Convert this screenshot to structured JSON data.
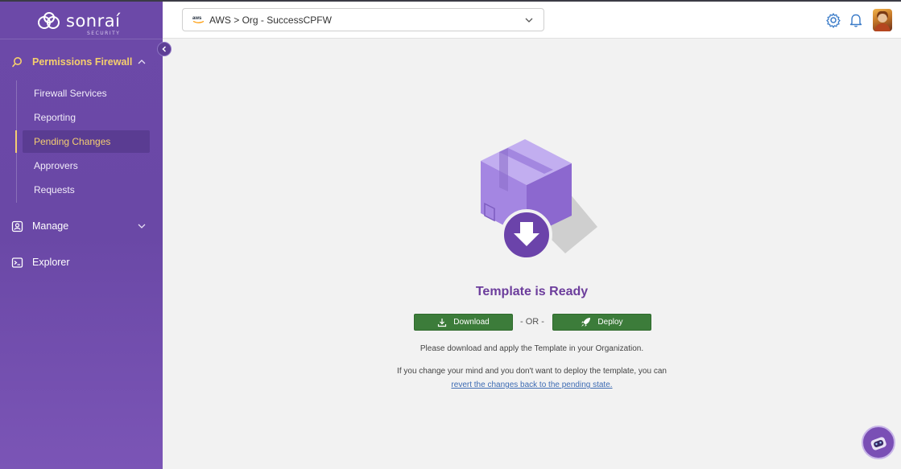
{
  "brand": {
    "name": "sonraí",
    "tagline": "SECURITY"
  },
  "sidebar": {
    "section": {
      "label": "Permissions Firewall",
      "icon": "search-icon",
      "expanded": true
    },
    "sub_items": [
      {
        "label": "Firewall Services"
      },
      {
        "label": "Reporting"
      },
      {
        "label": "Pending Changes",
        "active": true
      },
      {
        "label": "Approvers"
      },
      {
        "label": "Requests"
      }
    ],
    "items": [
      {
        "label": "Manage",
        "icon": "user-card-icon"
      },
      {
        "label": "Explorer",
        "icon": "terminal-icon"
      }
    ]
  },
  "header": {
    "org_select": {
      "provider": "aws",
      "value": "AWS > Org - SuccessCPFW"
    },
    "icons": [
      "gear-icon",
      "bell-icon",
      "avatar"
    ]
  },
  "main": {
    "title": "Template is Ready",
    "download_label": "Download",
    "or_label": "- OR -",
    "deploy_label": "Deploy",
    "info_line1": "Please download and apply the Template in your Organization.",
    "info_line2": "If you change your mind and you don't want to deploy the template, you can",
    "revert_link": "revert the changes back to the pending state."
  },
  "colors": {
    "sidebar": "#6c49a8",
    "accent": "#f4cd72",
    "title": "#6c3d9c",
    "button": "#3c7c3a",
    "link": "#3d6bb3"
  }
}
